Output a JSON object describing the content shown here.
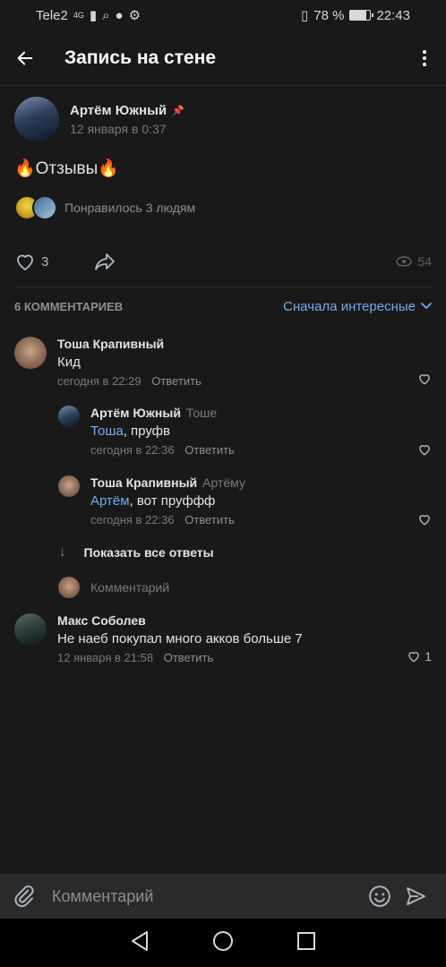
{
  "status_bar": {
    "carrier": "Tele2",
    "network": "4G",
    "battery": "78 %",
    "time": "22:43"
  },
  "header": {
    "title": "Запись на стене"
  },
  "post": {
    "author": "Артём Южный",
    "date": "12 января в 0:37",
    "text": "🔥Отзывы🔥",
    "likers_text": "Понравилось 3 людям",
    "likes": "3",
    "views": "54"
  },
  "comments_section": {
    "count_label": "6 КОММЕНТАРИЕВ",
    "sort_label": "Сначала интересные",
    "reply_label": "Ответить",
    "show_all_label": "Показать все ответы",
    "reply_placeholder": "Комментарий"
  },
  "comments": [
    {
      "author": "Тоша Крапивный",
      "to": "",
      "mention": "",
      "text": "Кид",
      "time": "сегодня в 22:29",
      "likes": ""
    },
    {
      "author": "Артём Южный",
      "to": "Тоше",
      "mention": "Тоша",
      "text": ", пруфв",
      "time": "сегодня в 22:36",
      "likes": ""
    },
    {
      "author": "Тоша Крапивный",
      "to": "Артёму",
      "mention": "Артём",
      "text": ", вот пруффф",
      "time": "сегодня в 22:36",
      "likes": ""
    },
    {
      "author": "Макс Соболев",
      "to": "",
      "mention": "",
      "text": "Не наеб покупал много акков больше 7",
      "time": "12 января в 21:58",
      "likes": "1"
    }
  ],
  "composer": {
    "placeholder": "Комментарий"
  },
  "colors": {
    "background": "#19191a",
    "accent": "#71aaeb",
    "text": "#e1e3e6",
    "secondary": "#76787a"
  },
  "icons": [
    "back-arrow-icon",
    "more-vertical-icon",
    "pin-icon",
    "heart-icon",
    "share-icon",
    "eye-icon",
    "chevron-down-icon",
    "arrow-down-icon",
    "paperclip-icon",
    "smile-icon",
    "send-icon",
    "nav-back-icon",
    "nav-home-icon",
    "nav-recents-icon"
  ]
}
